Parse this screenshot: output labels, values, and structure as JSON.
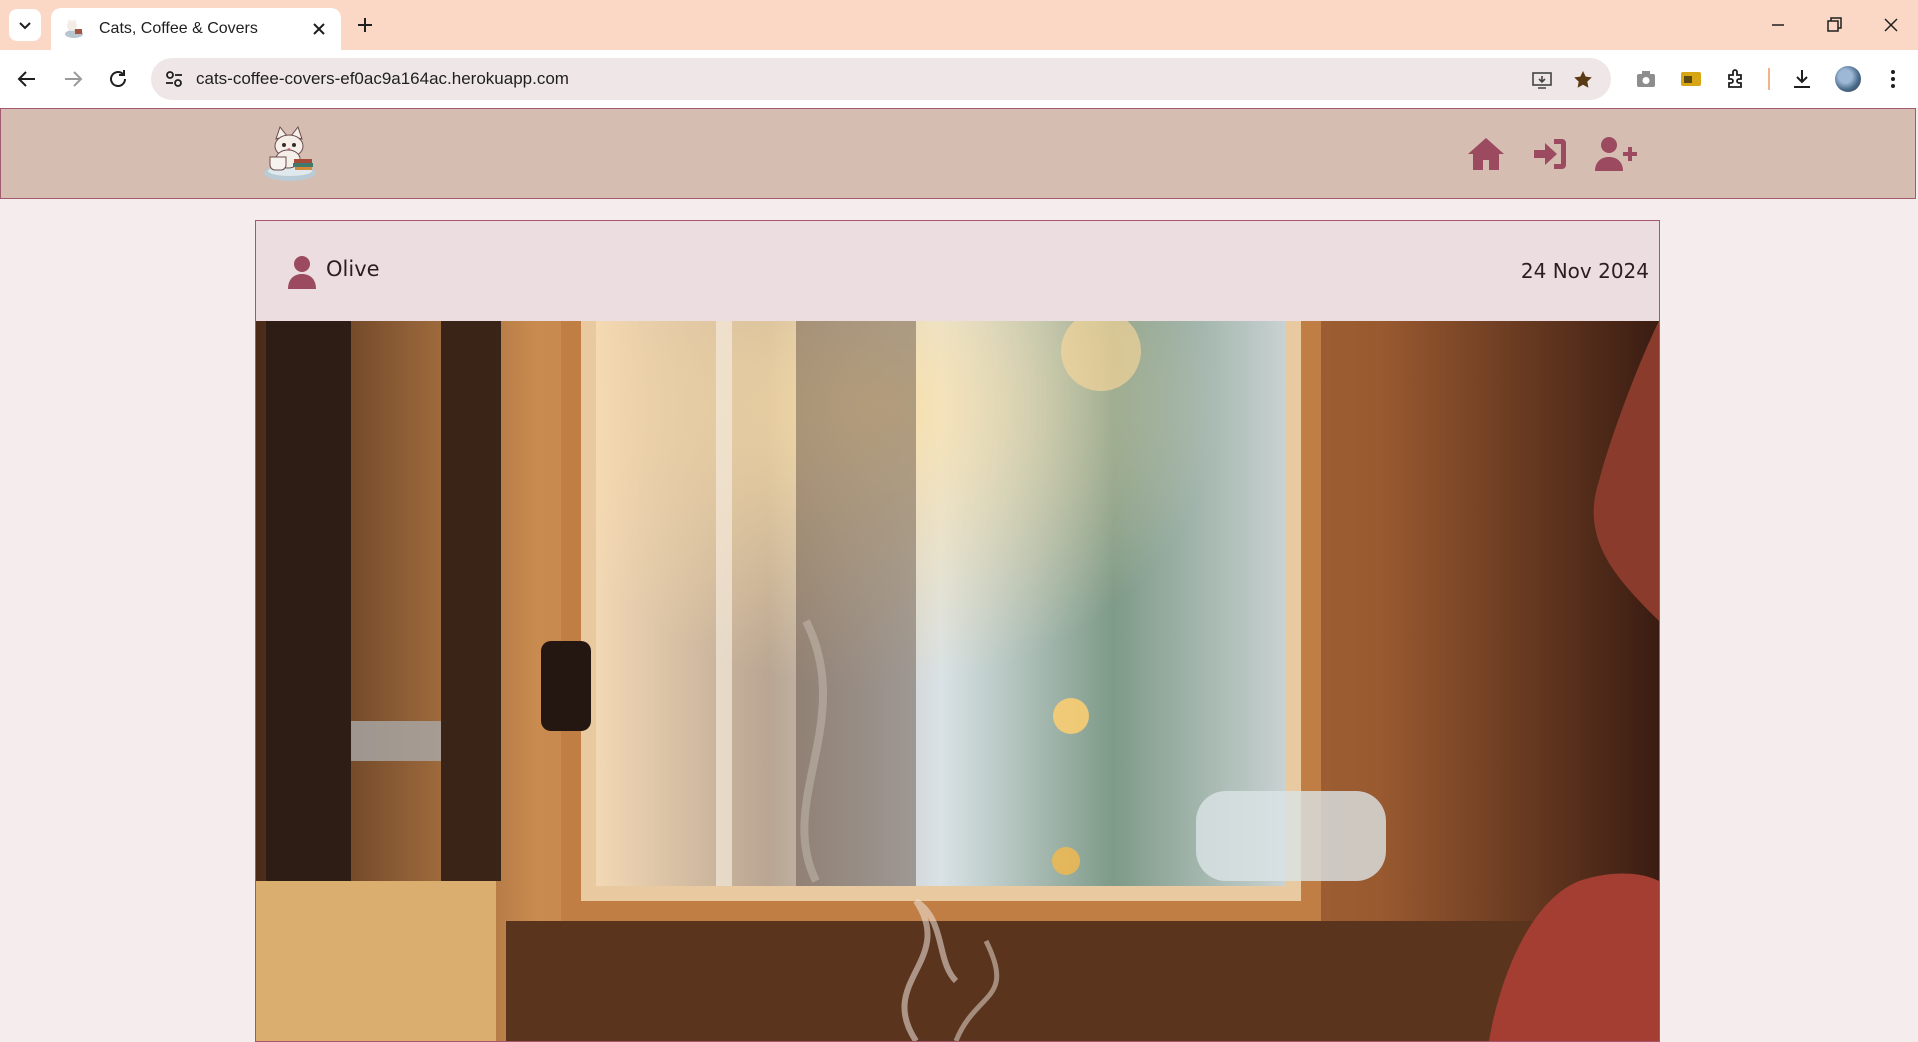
{
  "browser": {
    "tab_title": "Cats, Coffee & Covers",
    "url": "cats-coffee-covers-ef0ac9a164ac.herokuapp.com"
  },
  "site": {
    "nav_items": [
      "home-icon",
      "sign-in-icon",
      "user-plus-icon"
    ]
  },
  "post": {
    "author": "Olive",
    "date": "24 Nov 2024",
    "image_alt": "cafe-window-steaming-coffee-photo"
  },
  "colors": {
    "accent": "#9c4a60",
    "nav_bg": "#d6bdb2",
    "card_bg": "#ebdde0",
    "page_bg": "#f4eced",
    "tabbar_bg": "#fbd8c5"
  }
}
